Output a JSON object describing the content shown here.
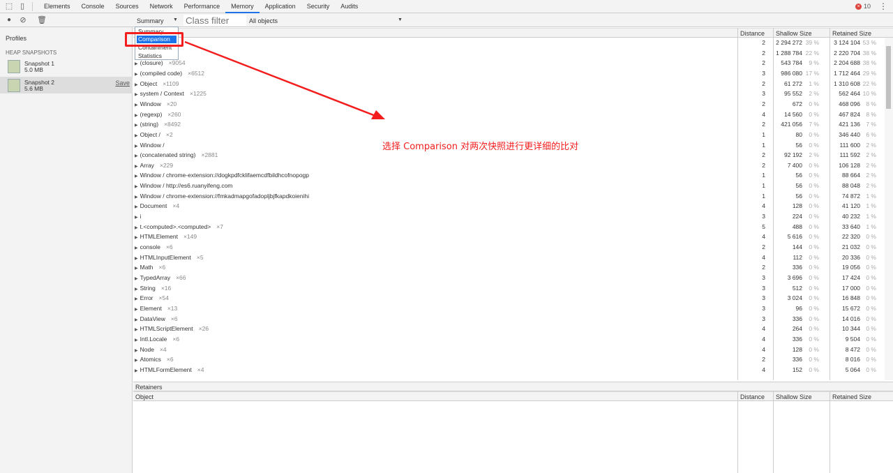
{
  "devtools": {
    "tabs": [
      "Elements",
      "Console",
      "Sources",
      "Network",
      "Performance",
      "Memory",
      "Application",
      "Security",
      "Audits"
    ],
    "active_tab": "Memory",
    "error_count": "10"
  },
  "toolbar": {
    "view_select": "Summary",
    "class_filter_placeholder": "Class filter",
    "objects_select": "All objects"
  },
  "sidebar": {
    "title": "Profiles",
    "section": "HEAP SNAPSHOTS",
    "snapshots": [
      {
        "name": "Snapshot 1",
        "size": "5.0 MB"
      },
      {
        "name": "Snapshot 2",
        "size": "5.6 MB",
        "save": "Save"
      }
    ]
  },
  "dropdown": {
    "options": [
      "Summary",
      "Comparison",
      "Containment",
      "Statistics"
    ],
    "highlighted": "Comparison"
  },
  "table": {
    "columns": {
      "distance": "Distance",
      "shallow": "Shallow Size",
      "retained": "Retained Size"
    },
    "rows": [
      [
        "",
        "",
        2,
        "2 294 272",
        "39 %",
        "3 124 104",
        "53 %"
      ],
      [
        "",
        "",
        2,
        "1 288 784",
        "22 %",
        "2 220 704",
        "38 %"
      ],
      [
        "(closure)",
        "×9054",
        2,
        "543 784",
        "9 %",
        "2 204 688",
        "38 %"
      ],
      [
        "(compiled code)",
        "×6512",
        3,
        "986 080",
        "17 %",
        "1 712 464",
        "29 %"
      ],
      [
        "Object",
        "×1109",
        2,
        "61 272",
        "1 %",
        "1 310 608",
        "22 %"
      ],
      [
        "system / Context",
        "×1225",
        3,
        "95 552",
        "2 %",
        "562 464",
        "10 %"
      ],
      [
        "Window",
        "×20",
        2,
        "672",
        "0 %",
        "468 096",
        "8 %"
      ],
      [
        "(regexp)",
        "×260",
        4,
        "14 560",
        "0 %",
        "467 824",
        "8 %"
      ],
      [
        "(string)",
        "×8492",
        2,
        "421 056",
        "7 %",
        "421 136",
        "7 %"
      ],
      [
        "Object /",
        "×2",
        1,
        "80",
        "0 %",
        "346 440",
        "6 %"
      ],
      [
        "Window /",
        "",
        1,
        "56",
        "0 %",
        "111 600",
        "2 %"
      ],
      [
        "(concatenated string)",
        "×2881",
        2,
        "92 192",
        "2 %",
        "111 592",
        "2 %"
      ],
      [
        "Array",
        "×229",
        2,
        "7 400",
        "0 %",
        "106 128",
        "2 %"
      ],
      [
        "Window / chrome-extension://dogkpdfcklifaemcdfbildhcofnopogp",
        "",
        1,
        "56",
        "0 %",
        "88 664",
        "2 %"
      ],
      [
        "Window / http://es6.ruanyifeng.com",
        "",
        1,
        "56",
        "0 %",
        "88 048",
        "2 %"
      ],
      [
        "Window / chrome-extension://fmkadmapgofadopljbjfkapdkoienihi",
        "",
        1,
        "56",
        "0 %",
        "74 872",
        "1 %"
      ],
      [
        "Document",
        "×4",
        4,
        "128",
        "0 %",
        "41 120",
        "1 %"
      ],
      [
        "i",
        "",
        3,
        "224",
        "0 %",
        "40 232",
        "1 %"
      ],
      [
        "t.<computed>.<computed>",
        "×7",
        5,
        "488",
        "0 %",
        "33 640",
        "1 %"
      ],
      [
        "HTMLElement",
        "×149",
        4,
        "5 616",
        "0 %",
        "22 320",
        "0 %"
      ],
      [
        "console",
        "×6",
        2,
        "144",
        "0 %",
        "21 032",
        "0 %"
      ],
      [
        "HTMLInputElement",
        "×5",
        4,
        "112",
        "0 %",
        "20 336",
        "0 %"
      ],
      [
        "Math",
        "×6",
        2,
        "336",
        "0 %",
        "19 056",
        "0 %"
      ],
      [
        "TypedArray",
        "×66",
        3,
        "3 696",
        "0 %",
        "17 424",
        "0 %"
      ],
      [
        "String",
        "×16",
        3,
        "512",
        "0 %",
        "17 000",
        "0 %"
      ],
      [
        "Error",
        "×54",
        3,
        "3 024",
        "0 %",
        "16 848",
        "0 %"
      ],
      [
        "Element",
        "×13",
        3,
        "96",
        "0 %",
        "15 672",
        "0 %"
      ],
      [
        "DataView",
        "×6",
        3,
        "336",
        "0 %",
        "14 016",
        "0 %"
      ],
      [
        "HTMLScriptElement",
        "×26",
        4,
        "264",
        "0 %",
        "10 344",
        "0 %"
      ],
      [
        "Intl.Locale",
        "×6",
        4,
        "336",
        "0 %",
        "9 504",
        "0 %"
      ],
      [
        "Node",
        "×4",
        4,
        "128",
        "0 %",
        "8 472",
        "0 %"
      ],
      [
        "Atomics",
        "×6",
        2,
        "336",
        "0 %",
        "8 016",
        "0 %"
      ],
      [
        "HTMLFormElement",
        "×4",
        4,
        "152",
        "0 %",
        "5 064",
        "0 %"
      ]
    ]
  },
  "retainers": {
    "title": "Retainers",
    "columns": {
      "object": "Object",
      "distance": "Distance",
      "shallow": "Shallow Size",
      "retained": "Retained Size"
    }
  },
  "annotation": {
    "text": "选择 Comparison 对两次快照进行更详细的比对",
    "color": "#f31d1d"
  }
}
